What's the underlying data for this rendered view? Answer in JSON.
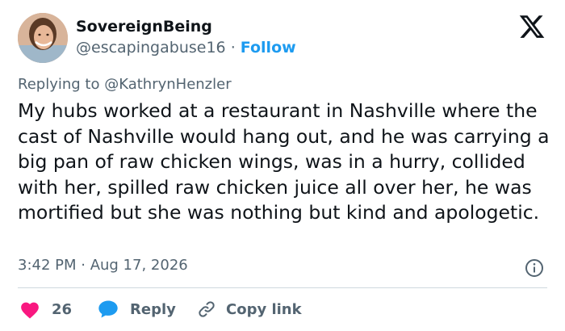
{
  "author": {
    "display_name": "SovereignBeing",
    "handle": "@escapingabuse16",
    "separator": "·",
    "follow_label": "Follow"
  },
  "reply_to": {
    "prefix": "Replying to",
    "mention": "@KathrynHenzler"
  },
  "tweet": {
    "text": "My hubs worked at a restaurant in Nashville where the cast of Nashville would hang out, and he was carrying a big pan of raw chicken wings, was in a hurry, collided with her, spilled raw chicken juice all over her, he was mortified but she was nothing but kind and apologetic.",
    "timestamp": "3:42 PM · Aug 17, 2026"
  },
  "actions": {
    "like_count": "26",
    "reply_label": "Reply",
    "copy_link_label": "Copy link"
  },
  "colors": {
    "accent": "#1d9bf0",
    "like": "#f91880",
    "muted": "#536471",
    "text": "#0f1419"
  },
  "icons": {
    "avatar": "avatar-photo",
    "logo": "x-logo-icon",
    "info": "info-icon",
    "like": "heart-icon",
    "reply": "speech-bubble-icon",
    "copy": "link-icon"
  }
}
